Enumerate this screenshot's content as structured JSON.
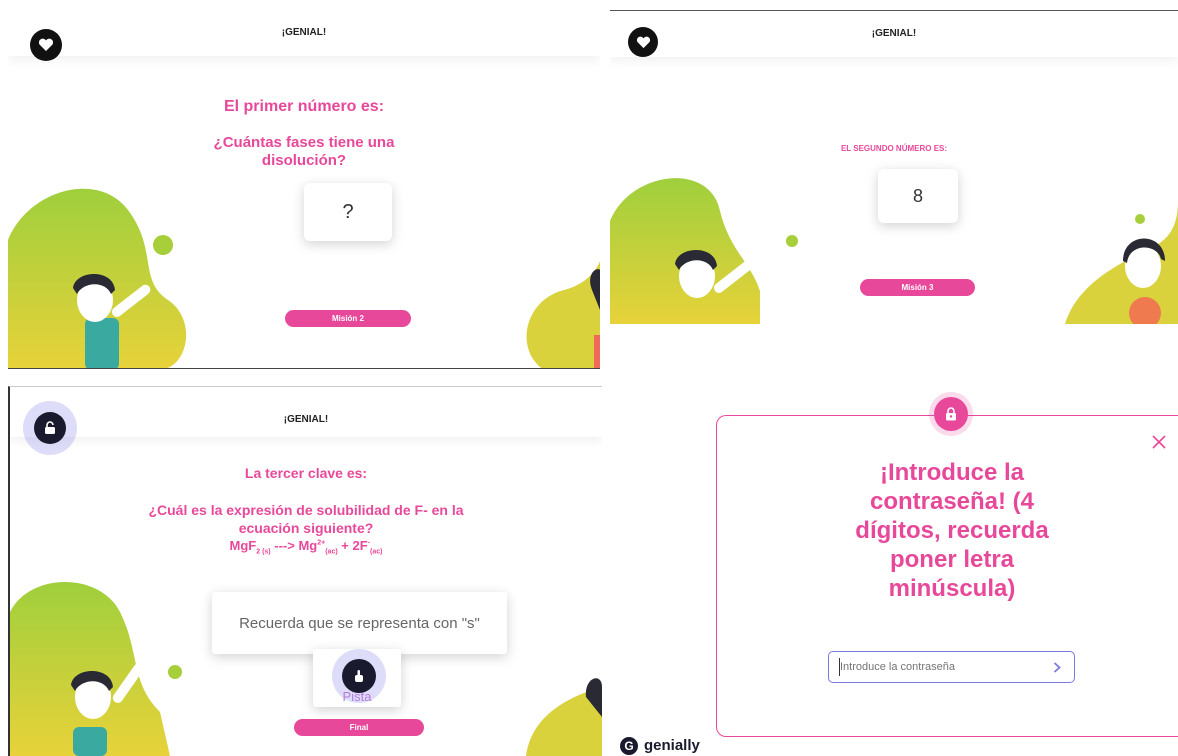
{
  "panel1": {
    "header": "¡GENIAL!",
    "heading": "El primer número es:",
    "question_line1": "¿Cuántas fases tiene una",
    "question_line2": "disolución?",
    "answer": "?",
    "button": "Misión 2"
  },
  "panel2": {
    "header": "¡GENIAL!",
    "heading": "EL SEGUNDO NÚMERO ES:",
    "answer": "8",
    "button": "Misión 3"
  },
  "panel3": {
    "header": "¡GENIAL!",
    "heading": "La tercer clave es:",
    "question_line1": "¿Cuál es la expresión de solubilidad de F- en la",
    "question_line2": "ecuación siguiente?",
    "formula": {
      "a": "MgF",
      "a_sub": "2 (s)",
      "arrow": " ---> Mg",
      "b_sup": "2+",
      "b_sub": "(ac)",
      "plus": " + 2F",
      "c_sup": "-",
      "c_sub": "(ac)"
    },
    "hint_text": "Recuerda que se representa con \"s\"",
    "hint_label": "Pista",
    "button": "Final"
  },
  "modal": {
    "title_lines": [
      "¡Introduce la",
      "contraseña! (4",
      "dígitos, recuerda",
      "poner letra",
      "minúscula)"
    ],
    "placeholder": "Introduce la contraseña",
    "submit_icon": "chevron-right-icon",
    "close_icon": "close-icon",
    "lock_icon": "lock-icon"
  },
  "branding": {
    "name": "genially"
  },
  "colors": {
    "accent": "#e8489a",
    "blob_green": "#a6cf3a",
    "blob_yellow": "#e3d23a",
    "input_border": "#7a7ae0"
  }
}
